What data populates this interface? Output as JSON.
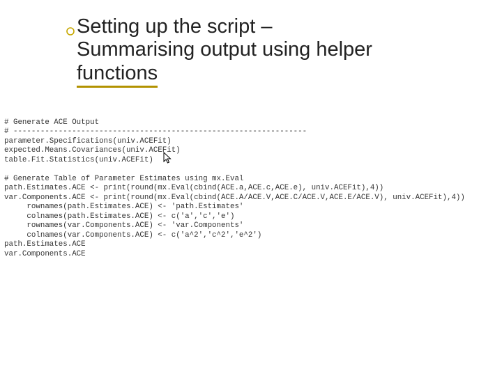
{
  "title": {
    "line1": "Setting up the script –",
    "line2": "Summarising output using helper",
    "line3": "functions"
  },
  "code": {
    "l1": "# Generate ACE Output",
    "l2": "# -----------------------------------------------------------------",
    "l3": "parameter.Specifications(univ.ACEFit)",
    "l4": "expected.Means.Covariances(univ.ACEFit)",
    "l5": "table.Fit.Statistics(univ.ACEFit)",
    "l6": "",
    "l7": "# Generate Table of Parameter Estimates using mx.Eval",
    "l8": "path.Estimates.ACE <- print(round(mx.Eval(cbind(ACE.a,ACE.c,ACE.e), univ.ACEFit),4))",
    "l9": "var.Components.ACE <- print(round(mx.Eval(cbind(ACE.A/ACE.V,ACE.C/ACE.V,ACE.E/ACE.V), univ.ACEFit),4))",
    "l10": "     rownames(path.Estimates.ACE) <- 'path.Estimates'",
    "l11": "     colnames(path.Estimates.ACE) <- c('a','c','e')",
    "l12": "     rownames(var.Components.ACE) <- 'var.Components'",
    "l13": "     colnames(var.Components.ACE) <- c('a^2','c^2','e^2')",
    "l14": "path.Estimates.ACE",
    "l15": "var.Components.ACE"
  }
}
